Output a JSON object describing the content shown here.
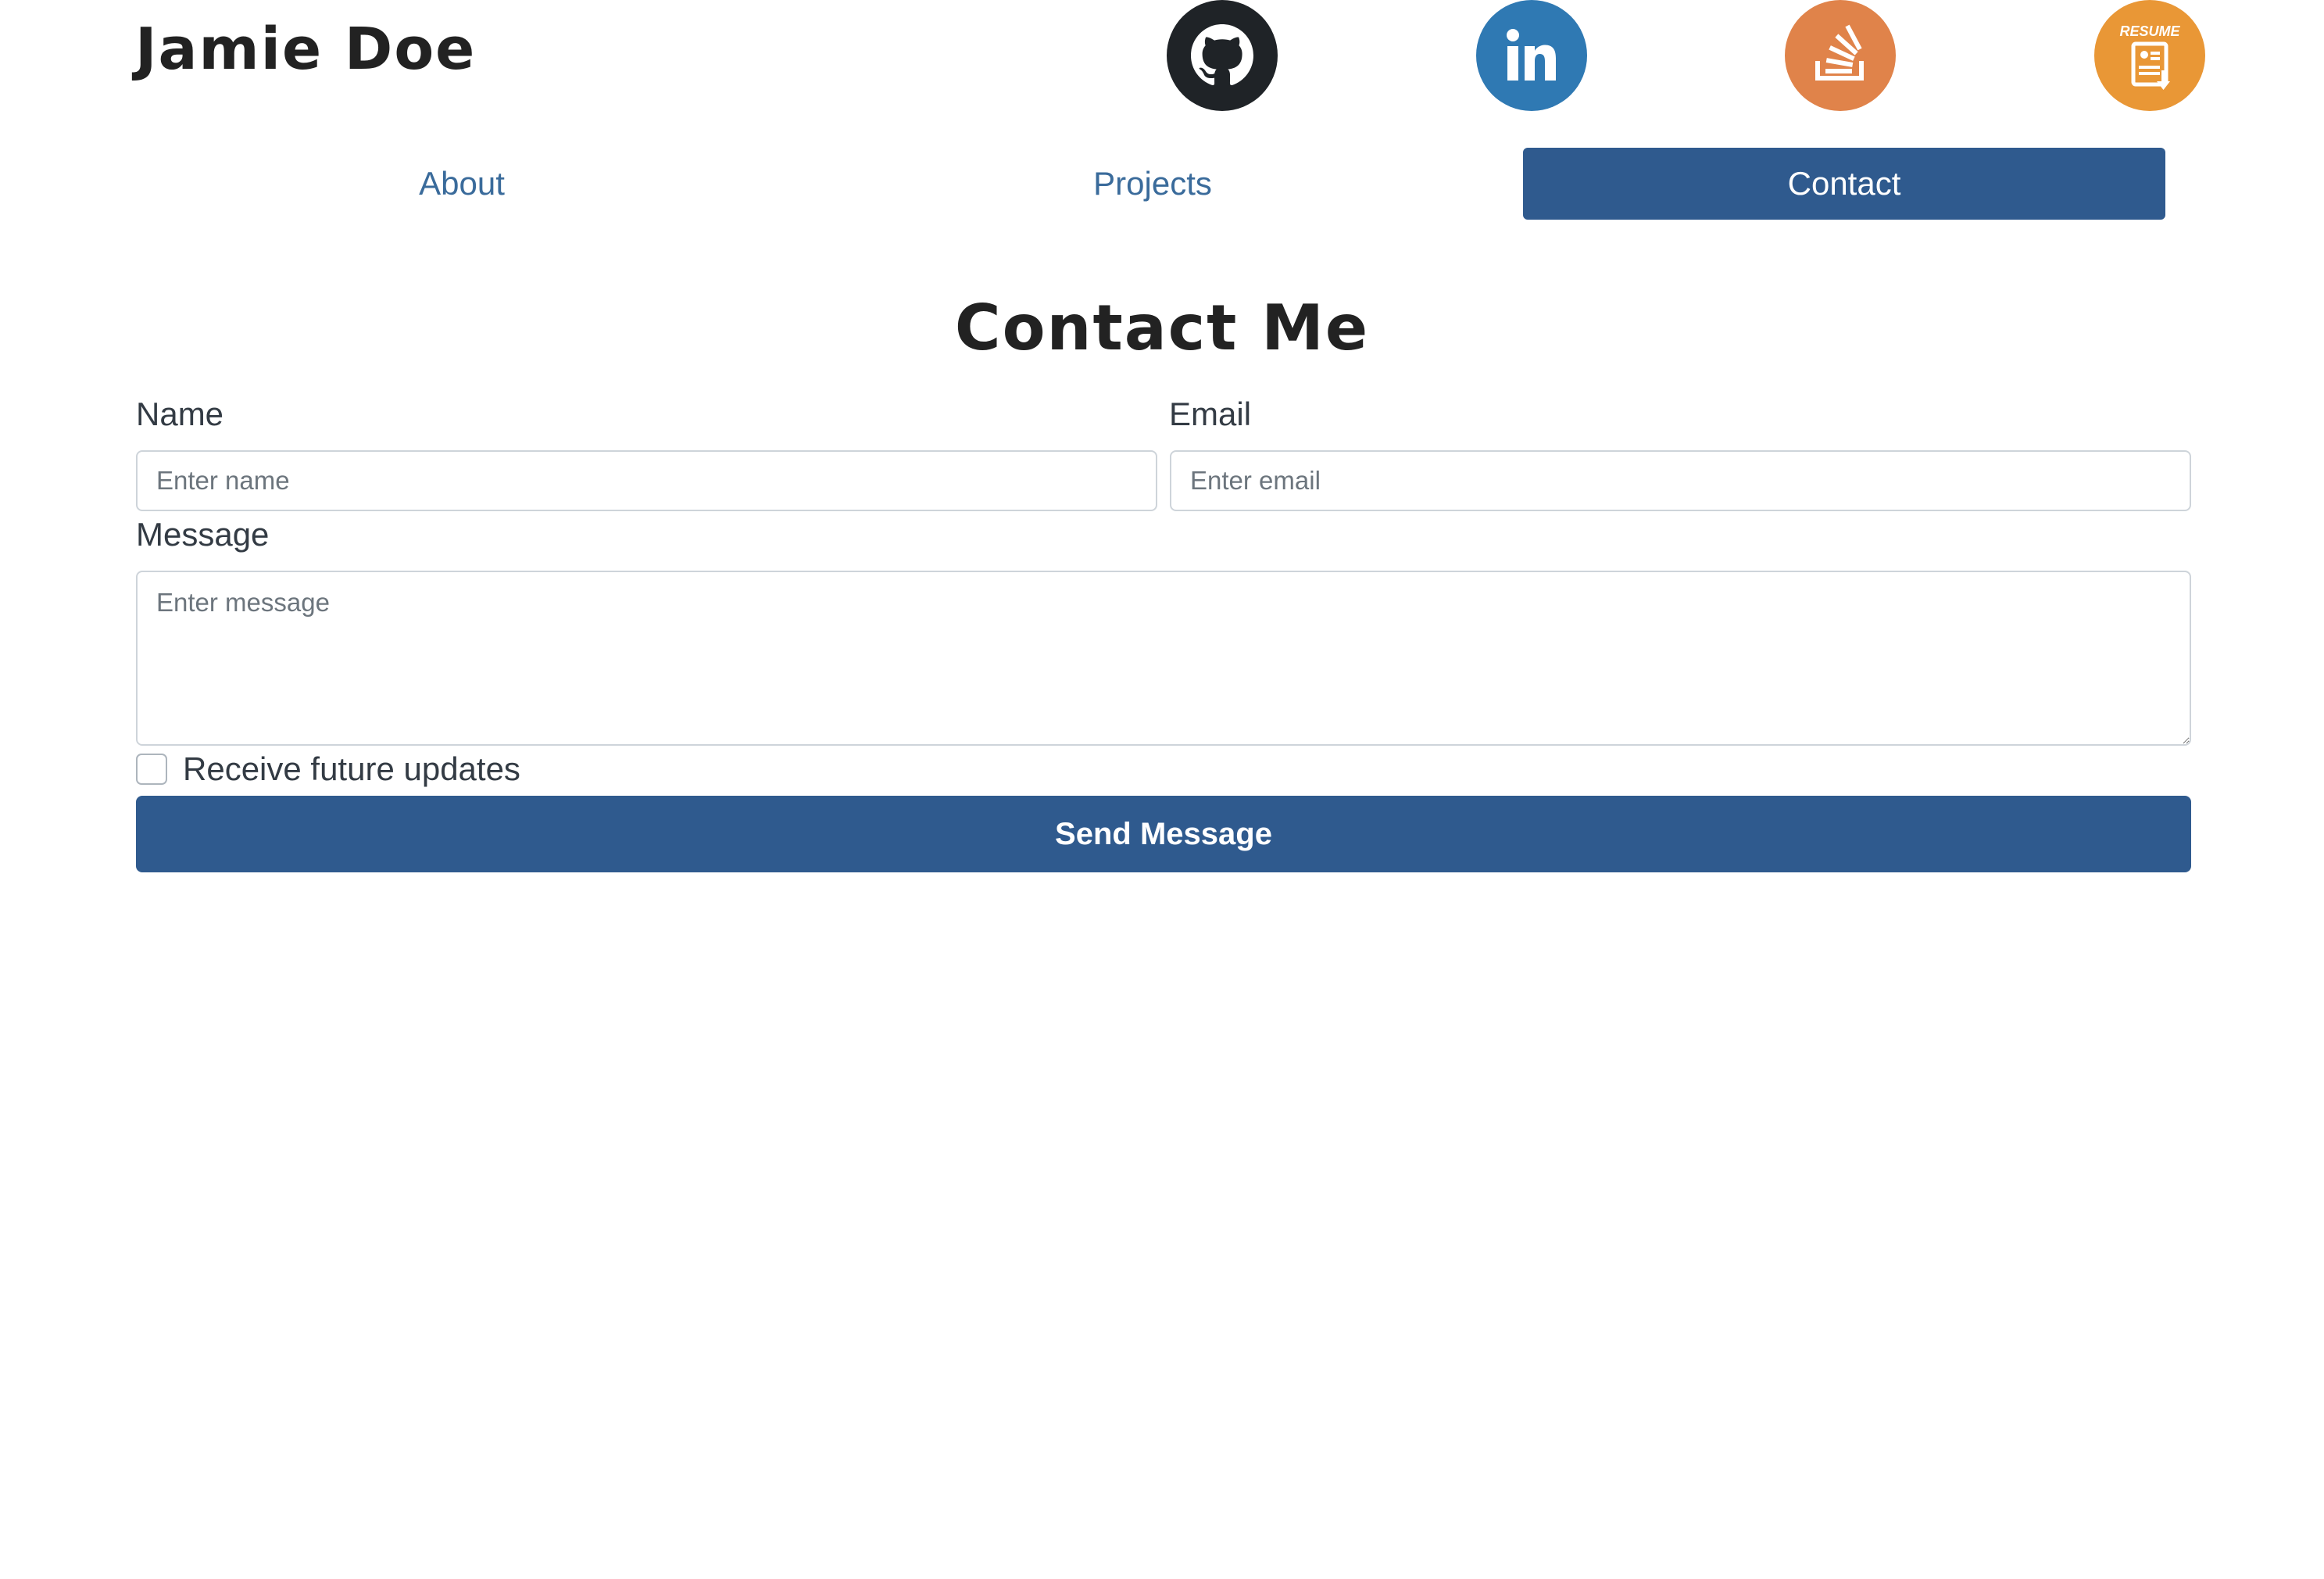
{
  "header": {
    "brand": "Jamie Doe",
    "social": [
      {
        "icon": "github-icon",
        "color": "#1f2327"
      },
      {
        "icon": "linkedin-icon",
        "color": "#2f79b3",
        "glyph": "in"
      },
      {
        "icon": "stack-overflow-icon",
        "color": "#e0834a"
      },
      {
        "icon": "resume-download-icon",
        "color": "#e99736",
        "caption": "RESUME"
      }
    ]
  },
  "nav": {
    "active": "Contact",
    "active_color": "#2f5a8e",
    "items": [
      {
        "label": "About"
      },
      {
        "label": "Projects"
      },
      {
        "label": "Contact"
      }
    ]
  },
  "contact": {
    "title": "Contact Me",
    "name_label": "Name",
    "name_placeholder": "Enter name",
    "name_value": "",
    "email_label": "Email",
    "email_placeholder": "Enter email",
    "email_value": "",
    "message_label": "Message",
    "message_placeholder": "Enter message",
    "message_value": "",
    "updates_label": "Receive future updates",
    "updates_checked": false,
    "send_label": "Send Message"
  }
}
